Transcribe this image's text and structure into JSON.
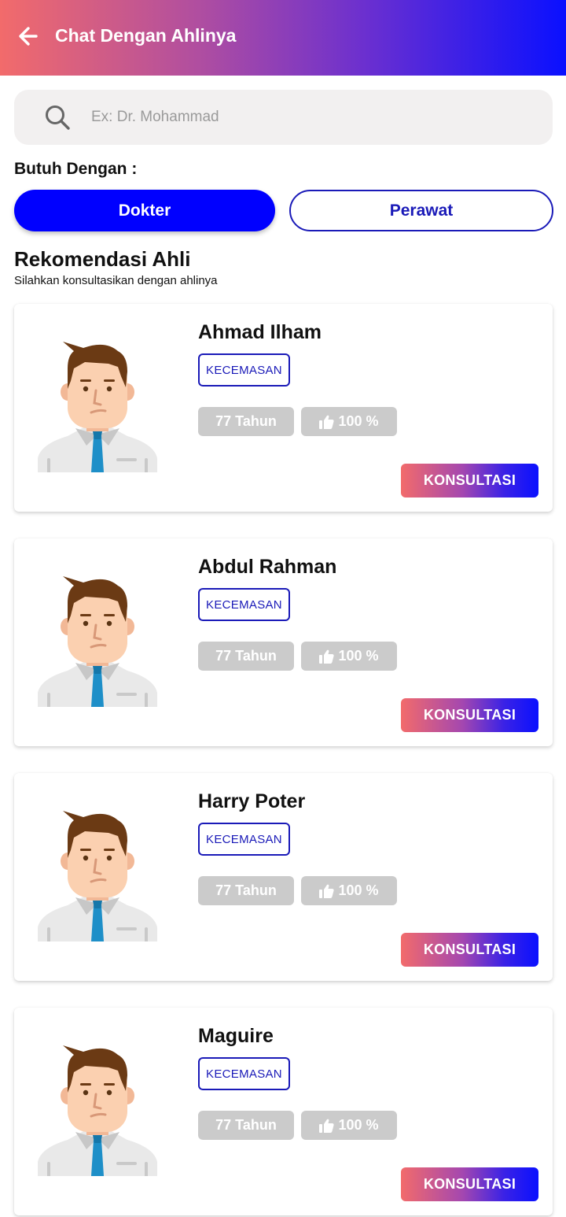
{
  "appbar": {
    "title": "Chat Dengan Ahlinya"
  },
  "search": {
    "placeholder": "Ex: Dr. Mohammad",
    "value": ""
  },
  "filter": {
    "label": "Butuh Dengan :",
    "options": [
      {
        "label": "Dokter",
        "selected": true
      },
      {
        "label": "Perawat",
        "selected": false
      }
    ]
  },
  "section": {
    "title": "Rekomendasi Ahli",
    "subtitle": "Silahkan konsultasikan dengan ahlinya"
  },
  "experts": [
    {
      "name": "Ahmad Ilham",
      "tag": "KECEMASAN",
      "age": "77 Tahun",
      "rating": "100 %",
      "button": "KONSULTASI"
    },
    {
      "name": "Abdul Rahman",
      "tag": "KECEMASAN",
      "age": "77 Tahun",
      "rating": "100 %",
      "button": "KONSULTASI"
    },
    {
      "name": "Harry Poter",
      "tag": "KECEMASAN",
      "age": "77 Tahun",
      "rating": "100 %",
      "button": "KONSULTASI"
    },
    {
      "name": "Maguire",
      "tag": "KECEMASAN",
      "age": "77 Tahun",
      "rating": "100 %",
      "button": "KONSULTASI"
    }
  ],
  "colors": {
    "primary": "#0000ff",
    "accent_start": "#f26b6b",
    "accent_end": "#0a10ff",
    "chip": "#cbcbcb"
  },
  "icons": {
    "back": "arrow-left-icon",
    "search": "search-icon",
    "rating": "thumbs-up-icon",
    "avatar": "man-avatar-icon"
  }
}
